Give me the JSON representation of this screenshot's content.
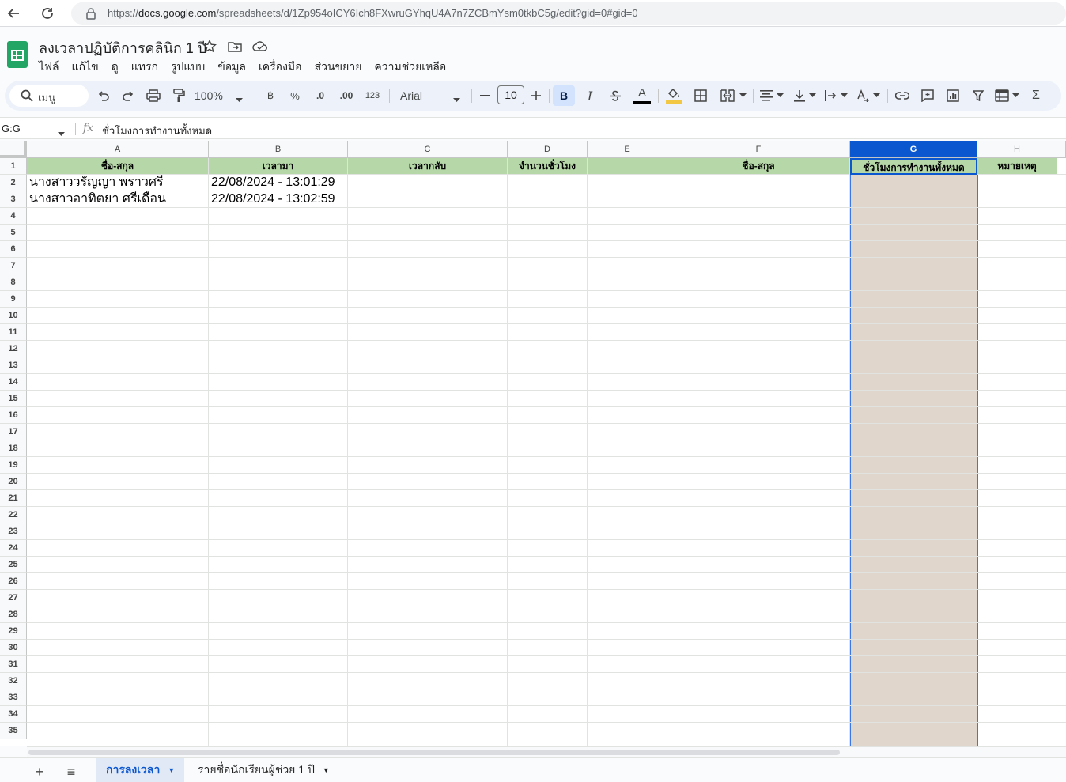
{
  "browser": {
    "url_prefix": "https://",
    "url_domain": "docs.google.com",
    "url_path": "/spreadsheets/d/1Zp954oICY6Ich8FXwruGYhqU4A7n7ZCBmYsm0tkbC5g/edit?gid=0#gid=0"
  },
  "doc": {
    "title": "ลงเวลาปฏิบัติการคลินิก 1 ปี",
    "menus": [
      "ไฟล์",
      "แก้ไข",
      "ดู",
      "แทรก",
      "รูปแบบ",
      "ข้อมูล",
      "เครื่องมือ",
      "ส่วนขยาย",
      "ความช่วยเหลือ"
    ]
  },
  "toolbar": {
    "menu_search": "เมนู",
    "zoom": "100%",
    "currency": "฿",
    "percent": "%",
    "dec_decrease": ".0",
    "dec_increase": ".00",
    "number_format": "123",
    "font": "Arial",
    "font_size": "10",
    "bold": "B",
    "italic": "I",
    "text_color": "A",
    "sum": "Σ"
  },
  "formula": {
    "name_box": "G:G",
    "fx": "fx",
    "content": "ชั่วโมงการทำงานทั้งหมด"
  },
  "grid": {
    "columns": [
      "A",
      "B",
      "C",
      "D",
      "E",
      "F",
      "G",
      "H"
    ],
    "selected_column": "G",
    "row_numbers": [
      "1",
      "2",
      "3",
      "4",
      "5",
      "6",
      "7",
      "8",
      "9",
      "10",
      "11",
      "12",
      "13",
      "14",
      "15",
      "16",
      "17",
      "18",
      "19",
      "20",
      "21",
      "22",
      "23",
      "24",
      "25",
      "26",
      "27",
      "28",
      "29",
      "30",
      "31",
      "32",
      "33",
      "34",
      "35"
    ],
    "header_row": [
      "ชื่อ-สกุล",
      "เวลามา",
      "เวลากลับ",
      "จำนวนชั่วโมง",
      "",
      "ชื่อ-สกุล",
      "ชั่วโมงการทำงานทั้งหมด",
      "หมายเหตุ"
    ],
    "rows": [
      [
        "นางสาววรัญญา  พราวศรี",
        "22/08/2024 - 13:01:29",
        "",
        "",
        "",
        "",
        "",
        ""
      ],
      [
        "นางสาวอาทิตยา  ศรีเดือน",
        "22/08/2024 - 13:02:59",
        "",
        "",
        "",
        "",
        "",
        ""
      ]
    ],
    "colors": {
      "header_fill": "#b6d7a8",
      "selected_column_fill": "#e1d6cc",
      "selection_accent": "#0b57d0"
    }
  },
  "sheets": {
    "add": "+",
    "list": "≡",
    "tabs": [
      {
        "label": "การลงเวลา",
        "active": true
      },
      {
        "label": "รายชื่อนักเรียนผู้ช่วย 1 ปี",
        "active": false
      }
    ]
  }
}
